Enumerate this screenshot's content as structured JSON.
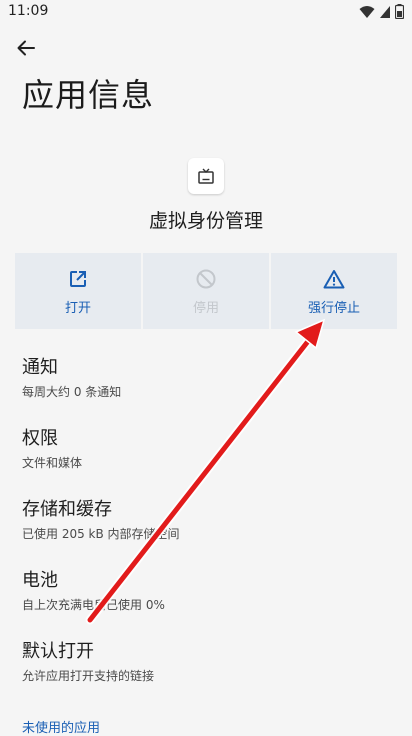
{
  "status_bar": {
    "time": "11:09"
  },
  "header": {
    "title": "应用信息"
  },
  "app": {
    "name": "虚拟身份管理",
    "icon": "tv-icon"
  },
  "actions": [
    {
      "label": "打开",
      "icon": "open-external-icon",
      "enabled": true
    },
    {
      "label": "停用",
      "icon": "block-icon",
      "enabled": false
    },
    {
      "label": "强行停止",
      "icon": "warning-icon",
      "enabled": true
    }
  ],
  "settings": [
    {
      "title": "通知",
      "subtitle": "每周大约 0 条通知"
    },
    {
      "title": "权限",
      "subtitle": "文件和媒体"
    },
    {
      "title": "存储和缓存",
      "subtitle": "已使用 205 kB 内部存储空间"
    },
    {
      "title": "电池",
      "subtitle": "自上次充满电后已使用 0%"
    },
    {
      "title": "默认打开",
      "subtitle": "允许应用打开支持的链接"
    }
  ],
  "unused_apps_link": "未使用的应用",
  "colors": {
    "accent": "#1a5fb4",
    "background": "#f5f5f5",
    "action_bg": "#e7ebf0",
    "arrow": "#e21b1b"
  }
}
